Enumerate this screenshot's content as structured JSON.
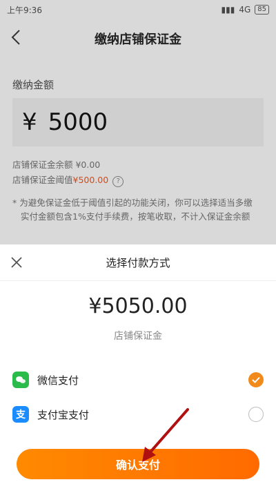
{
  "status": {
    "time": "上午9:36",
    "network": "4G",
    "battery": "85"
  },
  "nav": {
    "title": "缴纳店铺保证金"
  },
  "form": {
    "amount_label": "缴纳金额",
    "currency_symbol": "¥",
    "amount_value": "5000",
    "balance": "店铺保证金余额 ¥0.00",
    "threshold_prefix": "店铺保证金阈值",
    "threshold_value": "¥500.00",
    "help_icon": "?",
    "notice_line1": "* 为避免保证金低于阈值引起的功能关闭，你可以选择适当多缴",
    "notice_line2": "实付金额包含1%支付手续费，按笔收取，不计入保证金余额"
  },
  "sheet": {
    "title": "选择付款方式",
    "pay_amount": "¥5050.00",
    "pay_sub": "店铺保证金",
    "methods": [
      {
        "label": "微信支付",
        "icon": "wechat-icon",
        "selected": true
      },
      {
        "label": "支付宝支付",
        "icon": "alipay-icon",
        "selected": false
      }
    ],
    "confirm_label": "确认支付"
  },
  "colors": {
    "accent": "#ff7a00",
    "wechat": "#2bbb4a",
    "alipay": "#1a8cff",
    "threshold": "#d04a1a",
    "arrow": "#b01010"
  }
}
